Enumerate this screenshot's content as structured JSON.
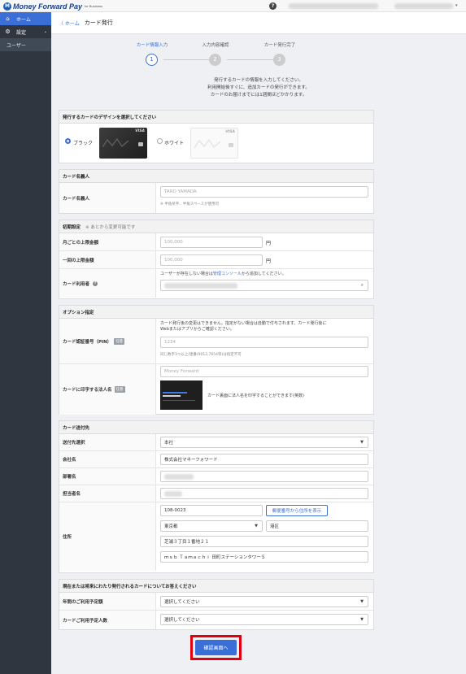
{
  "topbar": {
    "logo_mark": "M",
    "logo_text": "Money Forward Pay",
    "logo_sub": "for Business",
    "help_icon": "?",
    "account_caret": "▾"
  },
  "sidebar": {
    "items": [
      {
        "label": "ホーム",
        "icon": "home-icon",
        "glyph": "⌂"
      },
      {
        "label": "設定",
        "icon": "gear-icon",
        "glyph": "⚙",
        "chevron": "⌄"
      }
    ],
    "sub_items": [
      {
        "label": "ユーザー"
      }
    ]
  },
  "header": {
    "back": "〈 ホーム",
    "title": "カード発行"
  },
  "stepper": {
    "steps": [
      {
        "label": "カード情報入力",
        "num": "1"
      },
      {
        "label": "入力内容確認",
        "num": "2"
      },
      {
        "label": "カード発行完了",
        "num": "3"
      }
    ]
  },
  "intro": {
    "lines": [
      "発行するカードの情報を入力してください。",
      "利用開始後すぐに、追加カードの発行ができます。",
      "カードのお届けまでには1週間ほどかかります。"
    ]
  },
  "design": {
    "heading": "発行するカードのデザインを選択してください",
    "black_label": "ブラック",
    "white_label": "ホワイト",
    "visa": "VISA"
  },
  "holder": {
    "heading": "カード名義人",
    "label": "カード名義人",
    "placeholder": "TARO YAMADA",
    "hint": "※ 半角英字、半角スペースが使用可"
  },
  "initial": {
    "heading": "初期設定",
    "note": "※ あとから変更可能です",
    "monthly_label": "月ごとの上限金額",
    "monthly_placeholder": "100,000",
    "single_label": "一回の上限金額",
    "single_placeholder": "100,000",
    "unit": "円",
    "user_label": "カード利用者",
    "user_help": "?",
    "user_desc_pre": "ユーザーが存在しない場合は",
    "user_desc_link": "管理コンソール",
    "user_desc_post": "から追加してください。",
    "search_icon": "⌕"
  },
  "options": {
    "heading": "オプション指定",
    "pin_label": "カード認証番号（PIN）",
    "optional_tag": "任意",
    "pin_desc_1": "カード発行後の変更はできません。指定がない場合は自動で付与されます。カード発行後に",
    "pin_desc_2": "Webまたはアプリからご確認ください。",
    "pin_placeholder": "1234",
    "pin_hint": "同じ数字3つ以上/連番(9012,7654等)は指定不可",
    "corp_label": "カードに印字する法人名",
    "corp_value": "Money Forward",
    "corp_desc": "カード裏面に法人名を印字することができます(英数)"
  },
  "shipping": {
    "heading": "カード送付先",
    "dest_label": "送付先選択",
    "dest_value": "本社",
    "company_label": "会社名",
    "company_value": "株式会社マネーフォワード",
    "dept_label": "部署名",
    "person_label": "担当者名",
    "address_label": "住所",
    "zip": "108-0023",
    "zip_button": "郵便番号から住所を表示",
    "prefecture": "東京都",
    "city": "港区",
    "street": "芝浦３丁目１番地２１",
    "building": "ｍｓｂ Ｔａｍａｃｈｉ 田町ステーションタワーＳ"
  },
  "survey": {
    "heading": "現在または将来にわたり発行されるカードについてお答えください",
    "annual_label": "年間のご利用予定額",
    "annual_value": "選択してください",
    "count_label": "カードご利用予定人数",
    "count_value": "選択してください"
  },
  "cta": {
    "label": "確認画面へ"
  },
  "colors": {
    "accent": "#3a6fd8",
    "sidebar": "#2f3640",
    "highlight": "#e0000f"
  }
}
